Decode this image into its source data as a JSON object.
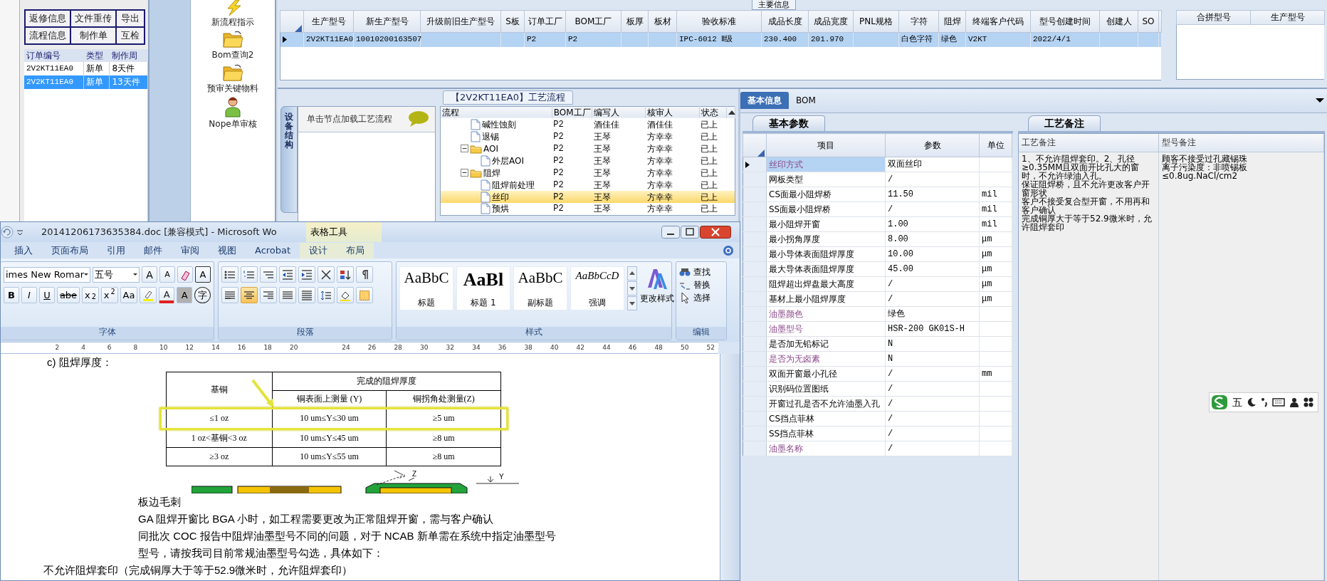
{
  "orders_panel": {
    "buttons": [
      {
        "label": "返修信息"
      },
      {
        "label": "文件重传"
      },
      {
        "label": "导出"
      },
      {
        "label": "流程信息"
      },
      {
        "label": "制作单"
      },
      {
        "label": "互检"
      }
    ],
    "columns": [
      "订单编号",
      "类型",
      "制作周"
    ],
    "rows": [
      {
        "cells": [
          "2V2KT11EA0",
          "新单",
          "8天件"
        ],
        "selected": false
      },
      {
        "cells": [
          "2V2KT11EA0",
          "新单",
          "13天件"
        ],
        "selected": true
      }
    ]
  },
  "launcher": [
    {
      "label": "新流程指示",
      "kind": "lightning"
    },
    {
      "label": "Bom查询2",
      "kind": "folder"
    },
    {
      "label": "预审关键物料",
      "kind": "folder"
    },
    {
      "label": "Nope单审核",
      "kind": "person"
    }
  ],
  "main_info": {
    "title": "主要信息",
    "columns": [
      "生产型号",
      "新生产型号",
      "升级前旧生产型号",
      "S板",
      "订单工厂",
      "BOM工厂",
      "板厚",
      "板材",
      "验收标准",
      "成品长度",
      "成品宽度",
      "PNL规格",
      "字符",
      "阻焊",
      "终端客户代码",
      "型号创建时间",
      "创建人",
      "SO"
    ],
    "rows": [
      {
        "cells": [
          "2V2KT11EA0",
          "10010200163507",
          null,
          null,
          "P2",
          "P2",
          null,
          null,
          "IPC-6012 Ⅱ级",
          "230.400",
          "201.970",
          null,
          "白色字符",
          "绿色",
          "V2KT",
          "2022/4/1",
          null,
          null
        ],
        "selected": true
      }
    ],
    "merge_columns": [
      "合拼型号",
      "生产型号"
    ]
  },
  "process": {
    "title": "【2V2KT11EA0】工艺流程",
    "side_tab": "设备结构",
    "hint": "单击节点加载工艺流程",
    "columns": [
      "流程",
      "BOM工厂",
      "编写人",
      "核审人",
      "状态"
    ],
    "tree": [
      {
        "kind": "step",
        "label": "碱性蚀刻",
        "factory": "P2",
        "writer": "酒佳佳",
        "reviewer": "酒佳佳",
        "status": "已上",
        "selected": false
      },
      {
        "kind": "step",
        "label": "退锡",
        "factory": "P2",
        "writer": "王琴",
        "reviewer": "方幸幸",
        "status": "已上",
        "selected": false
      },
      {
        "kind": "folder",
        "label": "AOI",
        "factory": "P2",
        "writer": "王琴",
        "reviewer": "方幸幸",
        "status": "已上",
        "selected": false,
        "expanded": true,
        "children": [
          {
            "kind": "step",
            "label": "外层AOI",
            "factory": "P2",
            "writer": "王琴",
            "reviewer": "方幸幸",
            "status": "已上",
            "selected": false
          }
        ]
      },
      {
        "kind": "folder",
        "label": "阻焊",
        "factory": "P2",
        "writer": "王琴",
        "reviewer": "方幸幸",
        "status": "已上",
        "selected": false,
        "expanded": true,
        "children": [
          {
            "kind": "step",
            "label": "阻焊前处理",
            "factory": "P2",
            "writer": "王琴",
            "reviewer": "方幸幸",
            "status": "已上",
            "selected": false
          },
          {
            "kind": "step",
            "label": "丝印",
            "factory": "P2",
            "writer": "王琴",
            "reviewer": "方幸幸",
            "status": "已上",
            "selected": true
          },
          {
            "kind": "step",
            "label": "预烘",
            "factory": "P2",
            "writer": "王琴",
            "reviewer": "方幸幸",
            "status": "已上",
            "selected": false
          }
        ]
      }
    ]
  },
  "info": {
    "tabs": [
      {
        "label": "基本信息",
        "selected": true
      },
      {
        "label": "BOM",
        "selected": false
      }
    ],
    "params": {
      "tab": "基本参数",
      "columns": [
        "项目",
        "参数",
        "单位"
      ],
      "rows": [
        {
          "item": "丝印方式",
          "value": "双面丝印",
          "flagged": true,
          "selected": true
        },
        {
          "item": "网板类型",
          "value": "/",
          "flagged": false,
          "selected": false
        },
        {
          "item": "CS面最小阻焊桥",
          "value": "11.50",
          "unit": "mil",
          "flagged": false,
          "selected": false
        },
        {
          "item": "SS面最小阻焊桥",
          "value": "/",
          "unit": "mil",
          "flagged": false,
          "selected": false
        },
        {
          "item": "最小阻焊开窗",
          "value": "1.00",
          "unit": "mil",
          "flagged": false,
          "selected": false
        },
        {
          "item": "最小拐角厚度",
          "value": "8.00",
          "unit": "μm",
          "flagged": false,
          "selected": false
        },
        {
          "item": "最小导体表面阻焊厚度",
          "value": "10.00",
          "unit": "μm",
          "flagged": false,
          "selected": false
        },
        {
          "item": "最大导体表面阻焊厚度",
          "value": "45.00",
          "unit": "μm",
          "flagged": false,
          "selected": false
        },
        {
          "item": "阻焊超出焊盘最大高度",
          "value": "/",
          "unit": "μm",
          "flagged": false,
          "selected": false
        },
        {
          "item": "基材上最小阻焊厚度",
          "value": "/",
          "unit": "μm",
          "flagged": false,
          "selected": false
        },
        {
          "item": "油墨颜色",
          "value": "绿色",
          "flagged": true,
          "selected": false
        },
        {
          "item": "油墨型号",
          "value": "HSR-200 GK01S-H",
          "flagged": true,
          "selected": false
        },
        {
          "item": "是否加无铅标记",
          "value": "N",
          "flagged": false,
          "selected": false
        },
        {
          "item": "是否为无卤素",
          "value": "N",
          "flagged": true,
          "selected": false
        },
        {
          "item": "双面开窗最小孔径",
          "value": "/",
          "unit": "mm",
          "flagged": false,
          "selected": false
        },
        {
          "item": "识别码位置图纸",
          "value": "/",
          "flagged": false,
          "selected": false
        },
        {
          "item": "开窗过孔是否不允许油墨入孔",
          "value": "/",
          "flagged": false,
          "selected": false
        },
        {
          "item": "CS挡点菲林",
          "value": "/",
          "flagged": false,
          "selected": false
        },
        {
          "item": "SS挡点菲林",
          "value": "/",
          "flagged": false,
          "selected": false
        },
        {
          "item": "油墨名称",
          "value": "/",
          "flagged": true,
          "selected": false
        }
      ]
    },
    "notes": {
      "tab": "工艺备注",
      "columns": [
        "工艺备注",
        "型号备注"
      ],
      "process_note": [
        "1、不允许阻焊套印。2、孔径≥0.35MM且双面开比孔大的窗时，不允许绿油入孔。",
        "保证阻焊桥，且不允许更改客户开窗形状",
        "客户不接受复合型开窗，不用再和客户确认",
        "完成铜厚大于等于52.9微米时，允许阻焊套印"
      ],
      "model_note": [
        "顾客不接受过孔藏锡珠",
        "离子污染度：非喷锡板≤0.8ug.NaCl/cm2"
      ]
    }
  },
  "ime_bar": {
    "mode": "五"
  },
  "word": {
    "title": "20141206173635384.doc [兼容模式] - Microsoft Wo",
    "context_title": "表格工具",
    "tabs": [
      {
        "label": "插入",
        "kind": "standard"
      },
      {
        "label": "页面布局",
        "kind": "standard"
      },
      {
        "label": "引用",
        "kind": "standard"
      },
      {
        "label": "邮件",
        "kind": "standard"
      },
      {
        "label": "审阅",
        "kind": "standard"
      },
      {
        "label": "视图",
        "kind": "standard"
      },
      {
        "label": "Acrobat",
        "kind": "standard"
      },
      {
        "label": "设计",
        "kind": "context"
      },
      {
        "label": "布局",
        "kind": "context"
      }
    ],
    "font_group": {
      "label": "字体",
      "font": "imes New Romar",
      "size": "五号",
      "grow": "A",
      "shrink": "A",
      "border_char": "A",
      "format_buttons": [
        "B",
        "I",
        "U",
        "abe",
        "x$_{2}$",
        "x$^{2}$",
        "Aa"
      ],
      "font_color": "A",
      "char_shading": "A",
      "enclose": "字"
    },
    "paragraph_group": {
      "label": "段落",
      "align_buttons": [
        {
          "selected": false
        },
        {
          "selected": true
        },
        {
          "selected": false
        },
        {
          "selected": false
        },
        {
          "selected": false
        }
      ]
    },
    "styles_group": {
      "label": "样式",
      "styles": [
        {
          "preview": "AaBbC",
          "label": "标题",
          "kind": "title"
        },
        {
          "preview": "AaBl",
          "label": "标题 1",
          "kind": "heading"
        },
        {
          "preview": "AaBbC",
          "label": "副标题",
          "kind": "subtitle"
        },
        {
          "preview": "AaBbCcD",
          "label": "强调",
          "kind": "emphasis"
        }
      ],
      "change_styles": "更改样式"
    },
    "editing_group": {
      "label": "编辑",
      "items": [
        {
          "label": "查找",
          "kind": "find"
        },
        {
          "label": "替换",
          "kind": "replace"
        },
        {
          "label": "选择",
          "kind": "select"
        }
      ]
    },
    "ruler": [
      "2",
      "4",
      "6",
      "8",
      "10",
      "12",
      "14",
      "16",
      "18",
      "20",
      "24",
      "26",
      "28",
      "30",
      "32",
      "34",
      "36",
      "38",
      "40",
      "42",
      "44",
      "46",
      "48",
      "50",
      "52"
    ],
    "doc": {
      "heading": "c) 阻焊厚度：",
      "table": {
        "base_label": "基铜",
        "group_label": "完成的阻焊厚度",
        "subheads": [
          "铜表面上测量 (Y)",
          "铜拐角处测量(Z)"
        ],
        "rows": [
          {
            "cells": [
              "≤1 oz",
              "10 um≤Y≤30 um",
              "≥5 um"
            ],
            "highlighted": true
          },
          {
            "cells": [
              "1 oz<基铜<3 oz",
              "10 um≤Y≤45 um",
              "≥8 um"
            ],
            "highlighted": false
          },
          {
            "cells": [
              "≥3 oz",
              "10 um≤Y≤55 um",
              "≥8 um"
            ],
            "highlighted": false
          }
        ]
      },
      "diagram_labels": [
        "Z",
        "Y"
      ],
      "lines": [
        {
          "text": "板边毛刺",
          "kind": "clipped"
        },
        {
          "text": "GA 阻焊开窗比 BGA 小时，如工程需要更改为正常阻焊开窗，需与客户确认",
          "kind": "clipped"
        },
        {
          "text": "同批次 COC 报告中阻焊油墨型号不同的问题，对于 NCAB 新单需在系统中指定油墨型号",
          "kind": "clipped"
        },
        {
          "text": "型号，请按我司目前常规油墨型号勾选，具体如下：",
          "kind": "clipped"
        },
        {
          "text": "不允许阻焊套印（完成铜厚大于等于52.9微米时，允许阻焊套印）",
          "kind": "body"
        }
      ]
    }
  }
}
